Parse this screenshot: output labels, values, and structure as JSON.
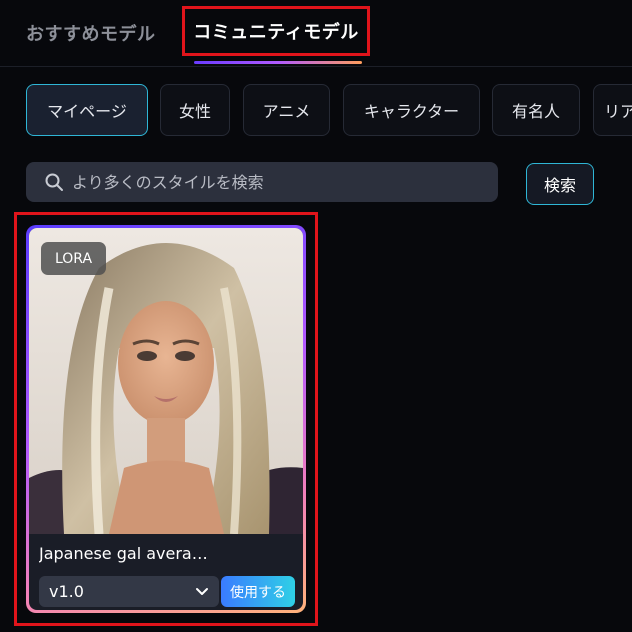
{
  "tabs": {
    "recommended": "おすすめモデル",
    "community": "コミュニティモデル"
  },
  "chips": [
    "マイページ",
    "女性",
    "アニメ",
    "キャラクター",
    "有名人",
    "リア"
  ],
  "search": {
    "placeholder": "より多くのスタイルを検索",
    "button": "検索"
  },
  "card": {
    "badge": "LORA",
    "title": "Japanese gal avera…",
    "version": "v1.0",
    "use_button": "使用する"
  },
  "colors": {
    "accent": "#2fb6d6",
    "highlight": "#e0141b"
  }
}
